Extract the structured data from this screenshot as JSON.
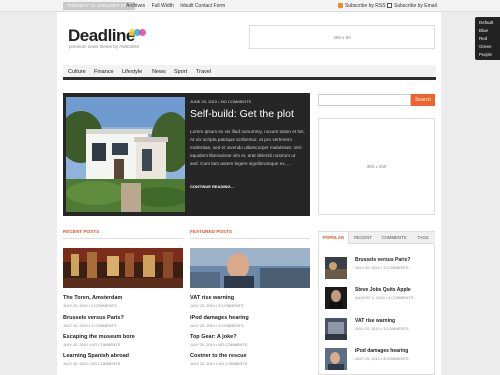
{
  "topbar": {
    "date": "TUESDAY 11 JANUARY 2011",
    "links": [
      "Archives",
      "Full Width",
      "Inbuilt Contact Form"
    ],
    "subscribe_rss": "Subscribe by RSS",
    "subscribe_email": "Subscribe by Email"
  },
  "header": {
    "logo": "Deadline",
    "tagline": "premium news theme by AWESEM",
    "ad_top": "468 x 60"
  },
  "nav": [
    "Culture",
    "Finance",
    "Lifestyle",
    "News",
    "Sport",
    "Travel"
  ],
  "feature": {
    "meta": "JUNE 20, 2010  •  NO COMMENTS",
    "title": "Self-build: Get the plot",
    "text": "Lorem ipsum ex vix illud nonummy, novum tation et his. At vix scripta patrique scribentur, at pro vertenem molestiae, sed et vivendo ullamcorper malulsiset. Veri equidem liberavisse vim ei, erat deleniti nostrum ut sed. Cum lam autem legere signiferumque ex, ...",
    "more": "CONTINUE READING..."
  },
  "search": {
    "button": "Search",
    "placeholder": ""
  },
  "ad_side": "300 x 250",
  "recent": {
    "heading": "RECENT POSTS",
    "posts": [
      {
        "title": "The Toren, Amsterdam",
        "meta": "JULY 20, 2010 • 3 COMMENTS"
      },
      {
        "title": "Brussels versus Paris?",
        "meta": "JULY 20, 2010 • 3 COMMENTS"
      },
      {
        "title": "Escaping the museum bore",
        "meta": "JULY 20, 2010 • NO COMMENTS"
      },
      {
        "title": "Learning Spanish abroad",
        "meta": "JULY 20, 2010 • NO COMMENTS"
      }
    ]
  },
  "featured": {
    "heading": "FEATURED POSTS",
    "posts": [
      {
        "title": "VAT rise warning",
        "meta": "JULY 20, 2010 • 3 COMMENTS"
      },
      {
        "title": "iPod damages hearing",
        "meta": "JULY 20, 2010 • 3 COMMENTS"
      },
      {
        "title": "Top Gear: A joke?",
        "meta": "JULY 20, 2010 • NO COMMENTS"
      },
      {
        "title": "Costner to the rescue",
        "meta": "JULY 20, 2010 • NO COMMENTS"
      }
    ]
  },
  "tabs": {
    "labels": [
      "POPULAR",
      "RECENT",
      "COMMENTS",
      "TAGS"
    ],
    "items": [
      {
        "title": "Brussels versus Paris?",
        "meta": "JULY 20, 2010 • 3 COMMENTS"
      },
      {
        "title": "Steve Jobs Quits Apple",
        "meta": "AUGUST 4, 2010 • 3 COMMENTS"
      },
      {
        "title": "VAT rise warning",
        "meta": "JULY 20, 2010 • 3 COMMENTS"
      },
      {
        "title": "iPod damages hearing",
        "meta": "JULY 20, 2010 • 3 COMMENTS"
      }
    ]
  },
  "switcher": [
    "Default",
    "Blue",
    "Red",
    "Green",
    "Purple"
  ],
  "colors": {
    "accent": "#e5501f",
    "dark": "#262626",
    "search": "#f0642b"
  }
}
